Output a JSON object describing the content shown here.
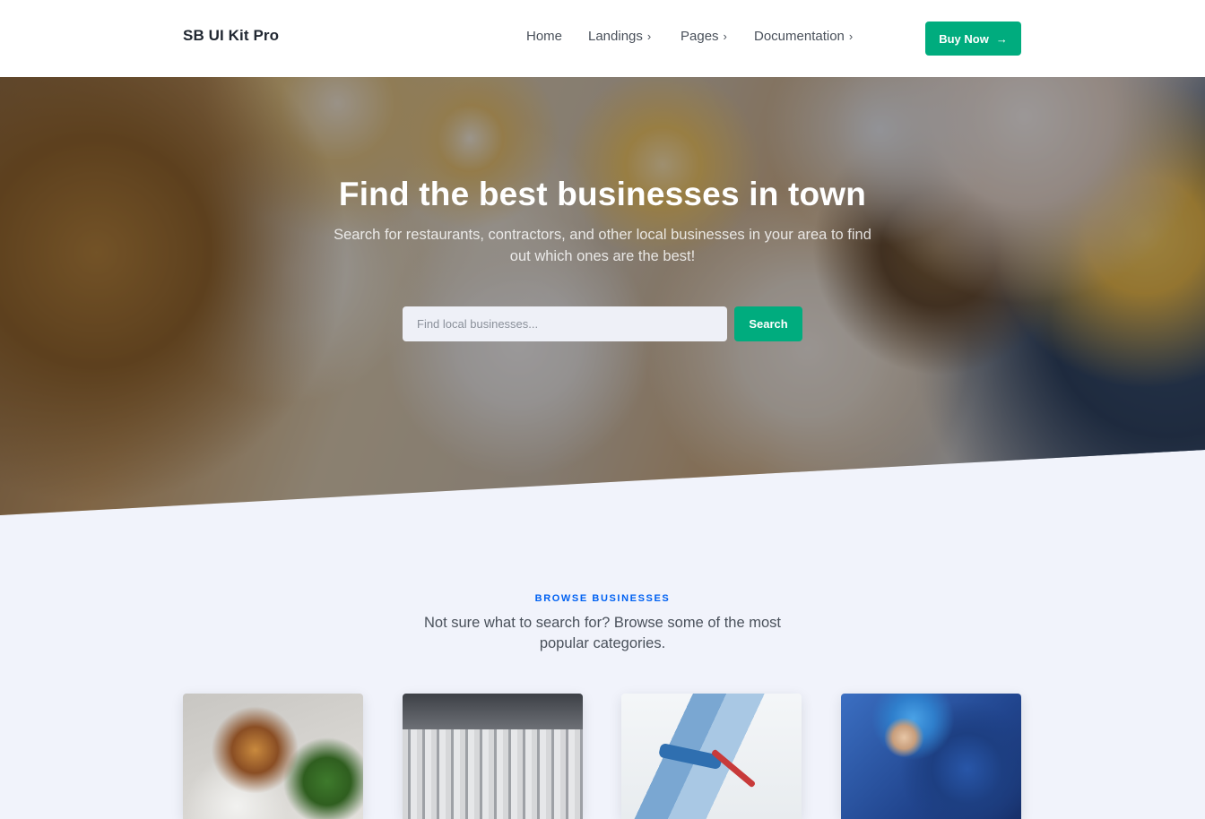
{
  "brand": {
    "name": "SB UI Kit Pro"
  },
  "nav": {
    "items": [
      {
        "label": "Home",
        "dropdown": false
      },
      {
        "label": "Landings",
        "dropdown": true
      },
      {
        "label": "Pages",
        "dropdown": true
      },
      {
        "label": "Documentation",
        "dropdown": true
      }
    ],
    "cta_label": "Buy Now"
  },
  "hero": {
    "title": "Find the best businesses in town",
    "subtitle": "Search for restaurants, contractors, and other local businesses in your area to find out which ones are the best!",
    "search": {
      "placeholder": "Find local businesses...",
      "value": "",
      "button_label": "Search"
    }
  },
  "browse": {
    "overline": "BROWSE BUSINESSES",
    "lead": "Not sure what to search for? Browse some of the most popular categories.",
    "cards": [
      {
        "image": "food-plate-image"
      },
      {
        "image": "dry-cleaning-image"
      },
      {
        "image": "paint-roller-image"
      },
      {
        "image": "surgery-image"
      }
    ]
  },
  "colors": {
    "accent": "#00ac7e",
    "overline": "#0061f2",
    "section_bg": "#f1f3fb"
  }
}
